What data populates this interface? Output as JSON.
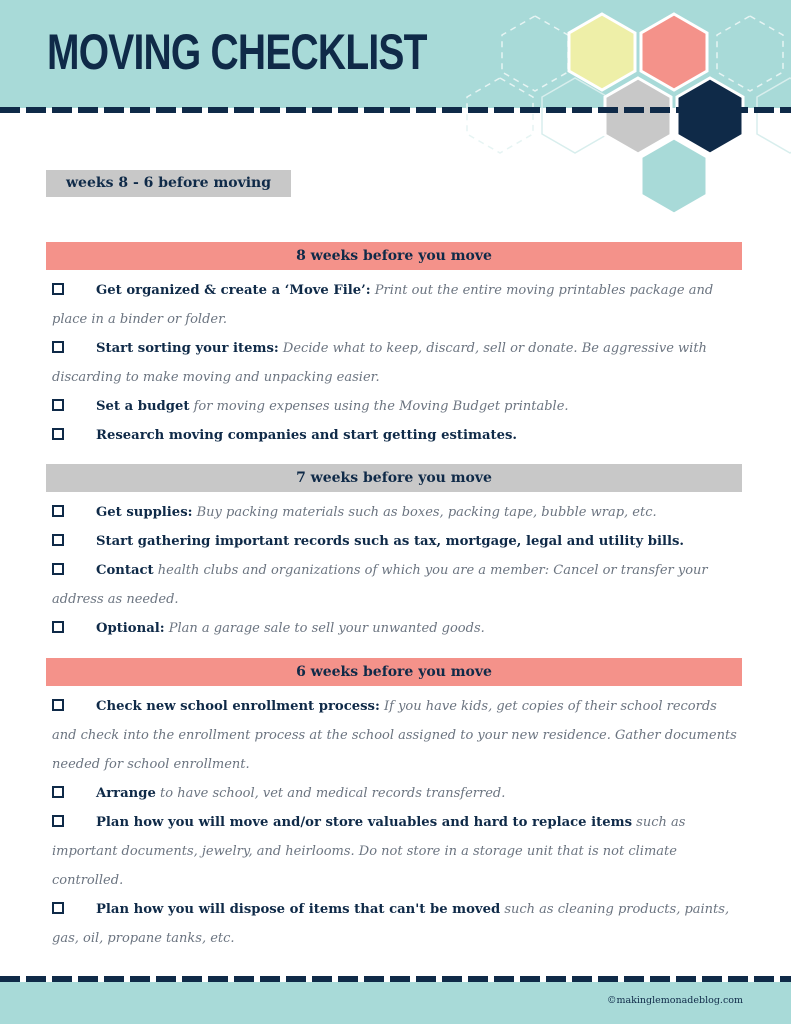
{
  "header": {
    "title": "MOVING CHECKLIST"
  },
  "colors": {
    "navy": "#0f2a48",
    "teal": "#a8dad8",
    "coral": "#f4928a",
    "gray": "#c8c8c8",
    "yellow": "#eeefa8"
  },
  "range_tag": "weeks 8 - 6 before moving",
  "sections": [
    {
      "heading": "8 weeks before you move",
      "items": [
        {
          "lead": "Get organized & create a ‘Move File’:",
          "desc": " Print out the entire moving printables package and place in a binder or folder."
        },
        {
          "lead": "Start sorting your items:",
          "desc": " Decide what to keep, discard, sell or donate. Be aggressive with discarding to make moving and unpacking easier."
        },
        {
          "lead": "Set a budget",
          "desc": " for moving expenses using the Moving Budget printable."
        },
        {
          "lead": "Research moving companies and start getting estimates.",
          "desc": ""
        }
      ]
    },
    {
      "heading": "7 weeks before you move",
      "items": [
        {
          "lead": "Get supplies:",
          "desc": " Buy packing materials such as boxes, packing tape, bubble wrap, etc."
        },
        {
          "lead": "Start gathering important records such as tax, mortgage, legal and utility bills.",
          "desc": ""
        },
        {
          "lead": "Contact",
          "desc": " health clubs and organizations of which you are a member: Cancel or transfer your address as needed."
        },
        {
          "lead": "Optional:",
          "desc": " Plan a garage sale to sell your unwanted goods."
        }
      ]
    },
    {
      "heading": "6 weeks before you move",
      "items": [
        {
          "lead": "Check new school enrollment process:",
          "desc": " If you have kids, get copies of their school records and check into the enrollment process at the school assigned to your new residence. Gather documents needed for school enrollment."
        },
        {
          "lead": "Arrange",
          "desc": " to have school, vet and medical records transferred."
        },
        {
          "lead": "Plan how you will move and/or store valuables and hard to replace items",
          "desc": " such as important documents, jewelry, and heirlooms. Do not store in a storage unit that is not climate controlled."
        },
        {
          "lead": "Plan how you will dispose of items that can't be moved",
          "desc": " such as cleaning products, paints, gas, oil, propane tanks, etc."
        }
      ]
    }
  ],
  "footer": {
    "copyright": "©makinglemonadeblog.com"
  }
}
